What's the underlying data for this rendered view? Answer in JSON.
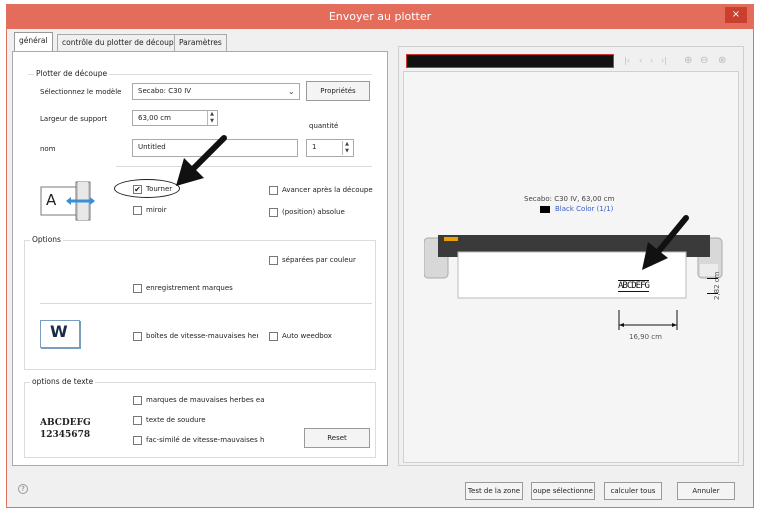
{
  "window": {
    "title": "Envoyer au plotter",
    "close_label": "×"
  },
  "tabs": [
    {
      "label": "général"
    },
    {
      "label": "contrôle du plotter de découpe"
    },
    {
      "label": "Paramètres"
    }
  ],
  "plotter": {
    "section_title": "Plotter de découpe",
    "model_label": "Sélectionnez le modèle",
    "model_value": "Secabo: C30 IV",
    "properties_button": "Propriétés",
    "media_width_label": "Largeur de support",
    "media_width_value": "63,00 cm",
    "quantity_label": "quantité",
    "quantity_value": "1",
    "name_label": "nom",
    "name_value": "Untitled",
    "rotate_label": "Tourner",
    "rotate_checked": true,
    "mirror_label": "miroir",
    "advance_label": "Avancer après la découpe",
    "absolute_label": "(position) absolue"
  },
  "options": {
    "section_title": "Options",
    "separate_color_label": "séparées par couleur",
    "register_marks_label": "enregistrement marques",
    "weed_boxes_label": "boîtes de vitesse-mauvaises her",
    "auto_weedbox_label": "Auto weedbox"
  },
  "text_options": {
    "section_title": "options de texte",
    "weed_marks_label": "marques de mauvaises herbes ea:",
    "weld_text_label": "texte de soudure",
    "weed_fax_label": "fac-similé de vitesse-mauvaises h",
    "reset_button": "Reset",
    "sample_line1": "ABCDEFG",
    "sample_line2": "12345678"
  },
  "preview": {
    "plotter_info": "Secabo: C30 IV,  63,00 cm",
    "color_legend": "Black Color (1/1)",
    "width_dim": "16,90 cm",
    "height_dim": "2,82 cm",
    "design_text": "ABCDEFG",
    "legend_color": "#000000",
    "link_color": "#3a5fcd"
  },
  "footer": {
    "help_icon": "?",
    "test_area_button": "Test de la zone",
    "group_selected_button": "oupe sélectionne",
    "calc_all_button": "calculer tous",
    "cancel_button": "Annuler"
  },
  "icons": {
    "rotate_glyph": "A",
    "weed_glyph": "W"
  }
}
